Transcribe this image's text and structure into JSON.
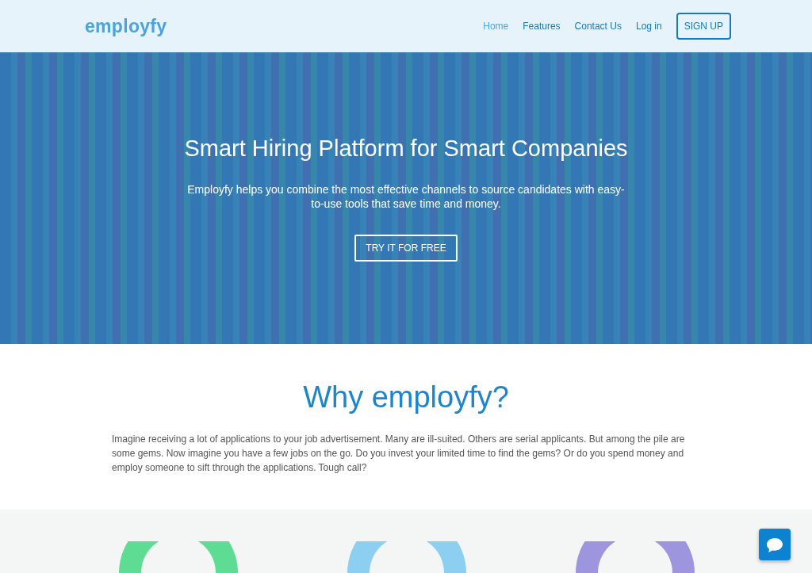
{
  "navbar": {
    "logo": "employfy",
    "links": [
      {
        "label": "Home",
        "selected": true
      },
      {
        "label": "Features",
        "selected": false
      },
      {
        "label": "Contact Us",
        "selected": false
      },
      {
        "label": "Log in",
        "selected": false
      }
    ],
    "signup": "SIGN UP"
  },
  "hero": {
    "title": "Smart Hiring Platform for Smart Companies",
    "subtitle": "Employfy helps you combine the most effective channels to source candidates with easy-to-use tools that save time and money.",
    "button": "TRY IT FOR FREE"
  },
  "why": {
    "title": "Why employfy?",
    "text": "Imagine receiving a lot of applications to your job advertisement. Many are ill-suited. Others are serial applicants. But among the pile are some gems. Now imagine you have a few jobs on the go. Do you invest your limited time to find the gems? Or do you spend money and employ someone to sift through the applications. Tough call?"
  },
  "features": [
    {
      "color": "#5fdc93"
    },
    {
      "color": "#8ccff0"
    },
    {
      "color": "#9d95dd"
    }
  ]
}
